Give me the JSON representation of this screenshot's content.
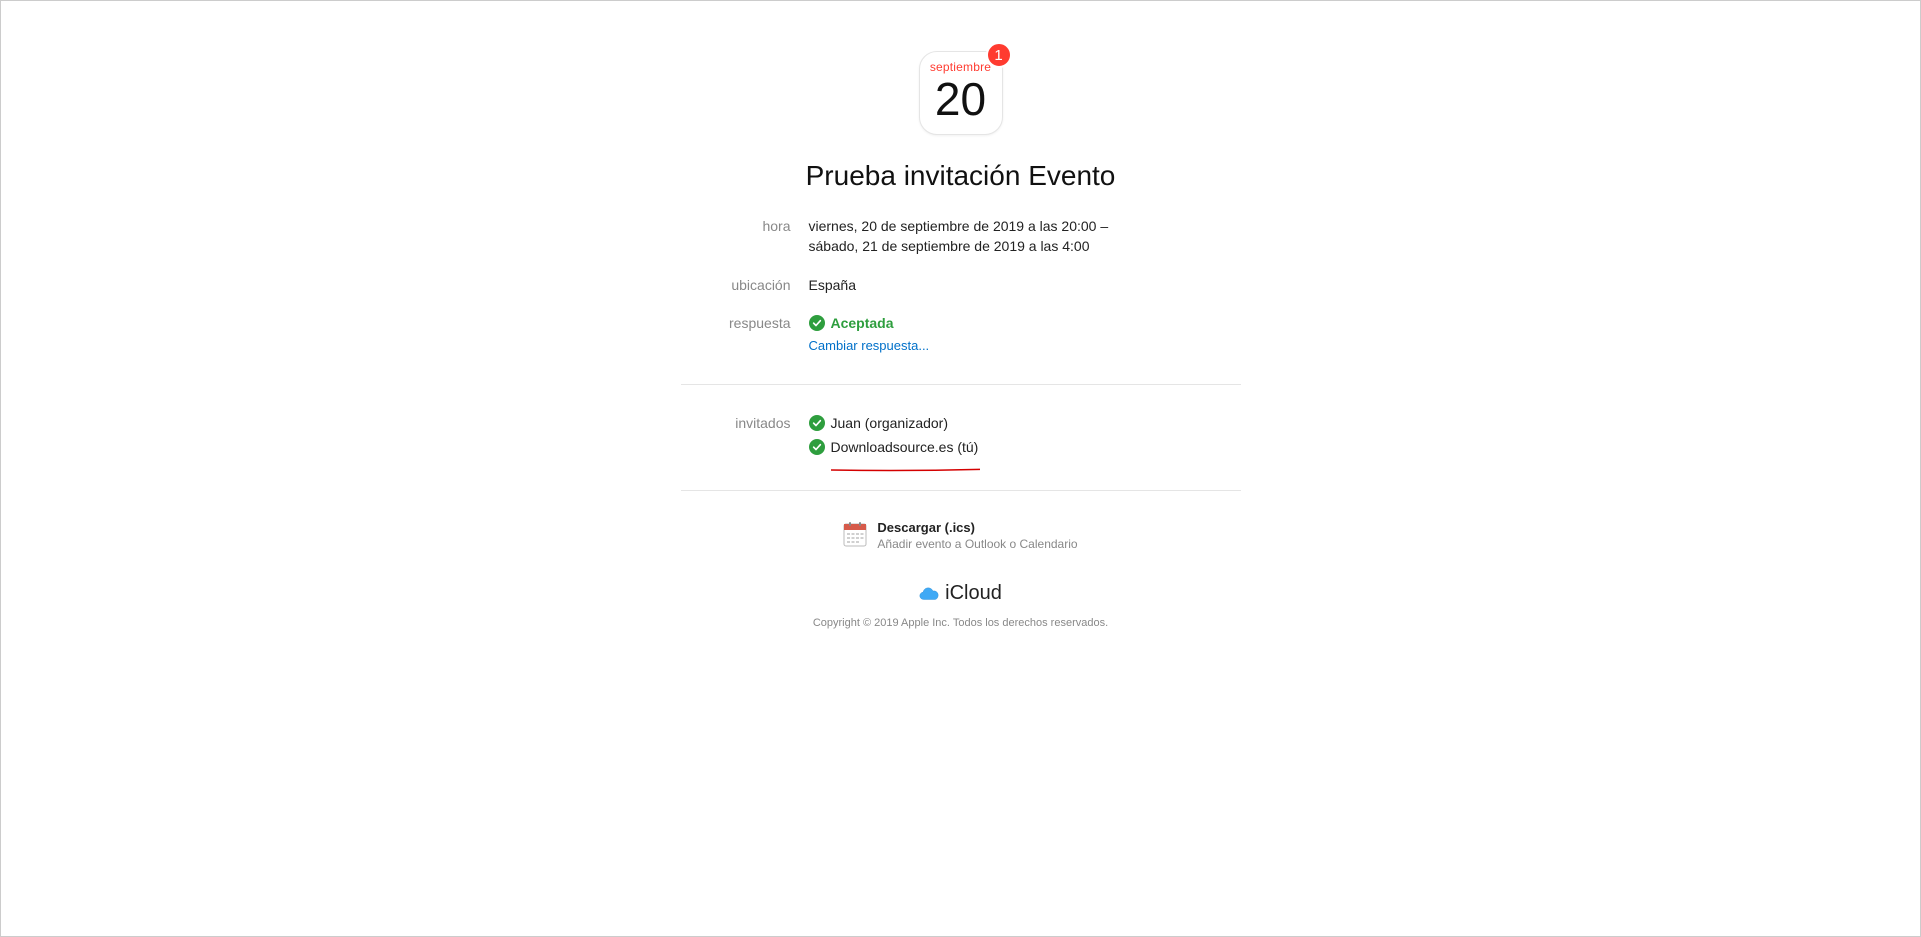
{
  "calendar": {
    "month": "septiembre",
    "day": "20",
    "badge": "1"
  },
  "event": {
    "title": "Prueba invitación Evento"
  },
  "labels": {
    "time": "hora",
    "location": "ubicación",
    "response": "respuesta",
    "invitees": "invitados"
  },
  "time": {
    "line1": "viernes, 20 de septiembre de 2019 a las 20:00 –",
    "line2": "sábado, 21 de septiembre de 2019 a las 4:00"
  },
  "location": "España",
  "response": {
    "status": "Aceptada",
    "change": "Cambiar respuesta..."
  },
  "invitees": {
    "organizer": "Juan (organizador)",
    "you": "Downloadsource.es (tú)"
  },
  "download": {
    "title": "Descargar (.ics)",
    "subtitle": "Añadir evento a Outlook o Calendario"
  },
  "footer": {
    "brand": "iCloud",
    "copyright": "Copyright © 2019 Apple Inc. Todos los derechos reservados."
  }
}
